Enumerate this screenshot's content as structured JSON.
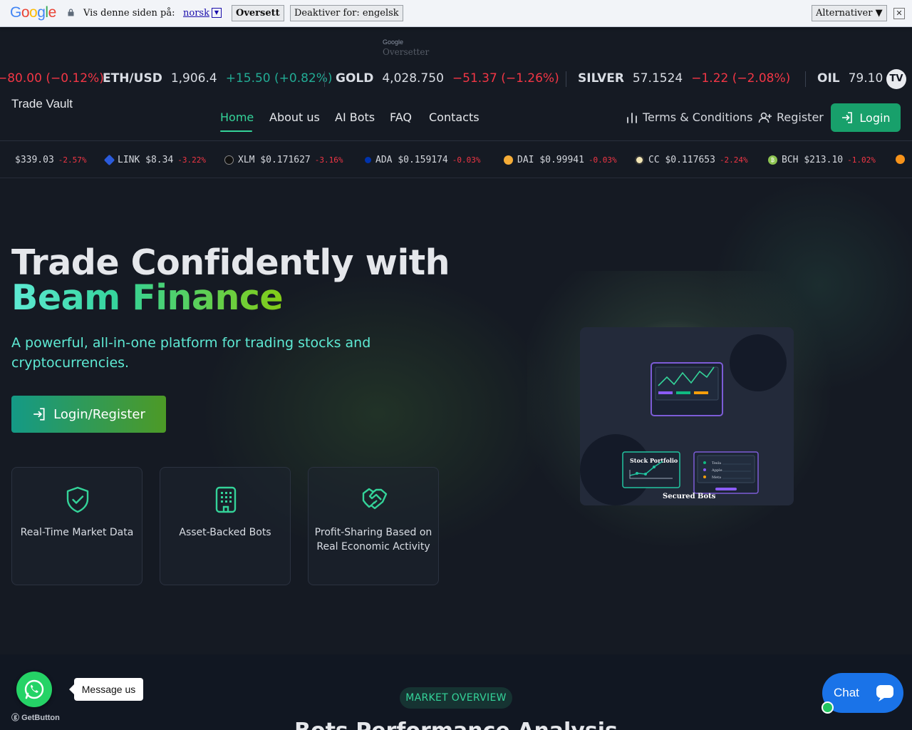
{
  "translate_bar": {
    "logo": "Google",
    "label": "Vis denne siden på:",
    "language": "norsk",
    "translate_button": "Oversett",
    "disable_button": "Deaktiver for: engelsk",
    "options_button": "Alternativer ▼",
    "close": "✕"
  },
  "translate_mini": {
    "brand": "Google",
    "label": "Oversetter"
  },
  "ticker_top": [
    {
      "symbol": "",
      "price": "",
      "change": "−80.00 (−0.12%)",
      "direction": "down"
    },
    {
      "symbol": "ETH/USD",
      "price": "1,906.4",
      "change": "+15.50 (+0.82%)",
      "direction": "up"
    },
    {
      "symbol": "GOLD",
      "price": "4,028.750",
      "change": "−51.37 (−1.26%)",
      "direction": "down"
    },
    {
      "symbol": "SILVER",
      "price": "57.1524",
      "change": "−1.22 (−2.08%)",
      "direction": "down"
    },
    {
      "symbol": "OIL",
      "price": "79.10",
      "change": "",
      "direction": "none"
    }
  ],
  "tradingview_badge": "TV",
  "nav": {
    "brand": "Trade Vault",
    "links": [
      "Home",
      "About us",
      "AI Bots",
      "FAQ",
      "Contacts"
    ],
    "terms": "Terms & Conditions",
    "register": "Register",
    "login": "Login"
  },
  "ticker_crypto": [
    {
      "symbol": "",
      "price": "$339.03",
      "change": "-2.57%",
      "color": "#000000"
    },
    {
      "symbol": "LINK",
      "price": "$8.34",
      "change": "-3.22%",
      "color": "#2a5ada"
    },
    {
      "symbol": "XLM",
      "price": "$0.171627",
      "change": "-3.16%",
      "color": "#111111"
    },
    {
      "symbol": "ADA",
      "price": "$0.159174",
      "change": "-0.03%",
      "color": "#0033ad"
    },
    {
      "symbol": "DAI",
      "price": "$0.99941",
      "change": "-0.03%",
      "color": "#f5ac37"
    },
    {
      "symbol": "CC",
      "price": "$0.117653",
      "change": "-2.24%",
      "color": "#f2e6b5"
    },
    {
      "symbol": "BCH",
      "price": "$213.10",
      "change": "-1.02%",
      "color": "#8dc351"
    }
  ],
  "hero": {
    "title_line1": "Trade Confidently with",
    "title_line2": "Beam Finance",
    "subtitle": "A powerful, all-in-one platform for trading stocks and cryptocurrencies.",
    "cta": "Login/Register"
  },
  "features": [
    {
      "icon": "shield-check-icon",
      "label": "Real-Time Market Data"
    },
    {
      "icon": "building-icon",
      "label": "Asset-Backed Bots"
    },
    {
      "icon": "handshake-icon",
      "label": "Profit-Sharing Based on Real Economic Activity"
    }
  ],
  "illustration": {
    "card1_label": "Stock Portfolio",
    "card2_items": [
      "Tesla",
      "Apple",
      "Meta"
    ],
    "caption": "Secured Bots"
  },
  "market": {
    "pill": "MARKET OVERVIEW",
    "title": "Bots Performance Analysis"
  },
  "widgets": {
    "whatsapp_bubble": "Message us",
    "getbutton": "GetButton",
    "chat_label": "Chat"
  },
  "colors": {
    "accent": "#34d399",
    "negative": "#f23645",
    "positive": "#22ab94",
    "brand_green": "#18a06b"
  }
}
